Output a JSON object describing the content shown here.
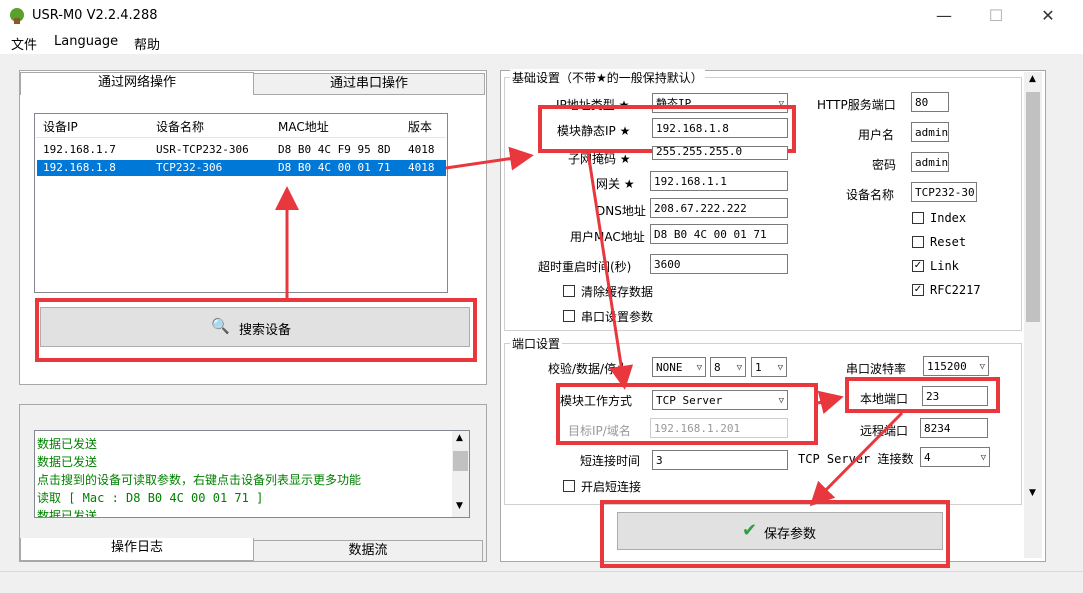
{
  "window": {
    "title": "USR-M0 V2.2.4.288",
    "minimize": "—",
    "maximize": "☐",
    "close": "✕"
  },
  "menu": [
    "文件",
    "Language",
    "帮助"
  ],
  "left_tabs": [
    "通过网络操作",
    "通过串口操作"
  ],
  "device_table": {
    "columns": [
      "设备IP",
      "设备名称",
      "MAC地址",
      "版本"
    ],
    "rows": [
      [
        "192.168.1.7",
        "USR-TCP232-306",
        "D8 B0 4C F9 95 8D",
        "4018"
      ],
      [
        "192.168.1.8",
        "TCP232-306",
        "D8 B0 4C 00 01 71",
        "4018"
      ]
    ],
    "selected_row": 1
  },
  "search_button": "搜索设备",
  "log": {
    "lines": [
      "数据已发送",
      "数据已发送",
      "点击搜到的设备可读取参数，右键点击设备列表显示更多功能",
      "读取 [ Mac : D8 B0 4C 00 01 71 ]",
      "数据已发送"
    ],
    "tabs": [
      "操作日志",
      "数据流"
    ]
  },
  "basic": {
    "title": "基础设置（不带★的一般保持默认）",
    "ip_type_label": "IP地址类型 ★",
    "ip_type_value": "静态IP",
    "static_ip_label": "模块静态IP ★",
    "static_ip_value": "192.168.1.8",
    "subnet_label": "子网掩码 ★",
    "subnet_value": "255.255.255.0",
    "gateway_label": "网关 ★",
    "gateway_value": "192.168.1.1",
    "dns_label": "DNS地址",
    "dns_value": "208.67.222.222",
    "mac_label": "用户MAC地址",
    "mac_value": "D8 B0 4C 00 01 71",
    "timeout_label": "超时重启时间(秒)",
    "timeout_value": "3600",
    "clear_cache_label": "清除缓存数据",
    "serial_param_label": "串口设置参数",
    "http_port_label": "HTTP服务端口",
    "http_port_value": "80",
    "user_label": "用户名",
    "user_value": "admin",
    "pass_label": "密码",
    "pass_value": "admin",
    "devname_label": "设备名称",
    "devname_value": "TCP232-30",
    "checks": [
      {
        "label": "Index",
        "checked": false
      },
      {
        "label": "Reset",
        "checked": false
      },
      {
        "label": "Link",
        "checked": true
      },
      {
        "label": "RFC2217",
        "checked": true
      }
    ]
  },
  "port": {
    "title": "端口设置",
    "parity_label": "校验/数据/停止",
    "parity": "NONE",
    "databits": "8",
    "stopbits": "1",
    "baud_label": "串口波特率",
    "baud_value": "115200",
    "mode_label": "模块工作方式",
    "mode_value": "TCP Server",
    "target_label": "目标IP/域名",
    "target_value": "192.168.1.201",
    "local_port_label": "本地端口",
    "local_port_value": "23",
    "remote_port_label": "远程端口",
    "remote_port_value": "8234",
    "short_time_label": "短连接时间",
    "short_time_value": "3",
    "conn_count_label": "TCP Server 连接数",
    "conn_count_value": "4",
    "short_conn_label": "开启短连接"
  },
  "save_button": "保存参数",
  "colors": {
    "accent_red": "#e8383d",
    "selection": "#0078d7",
    "log_green": "#008000"
  }
}
